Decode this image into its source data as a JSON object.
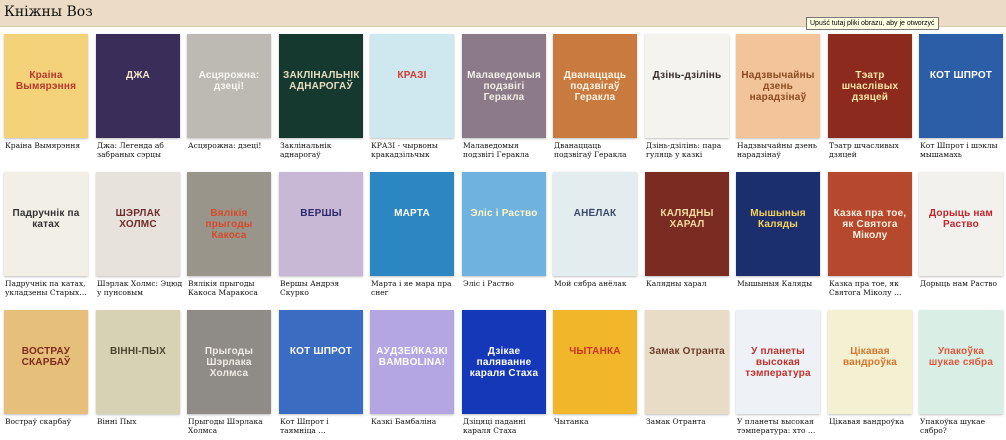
{
  "app": {
    "title": "Кніжны Воз",
    "tooltip": "Upuść tutaj pliki obrazu, aby je otworzyć"
  },
  "rows": [
    [
      {
        "title": "Краіна Вымярэння",
        "cover_text": "Краіна Вымярэння",
        "bg": "#f3d27a",
        "fg": "#b6382c"
      },
      {
        "title": "Джа: Легенда аб забраных сэрцы",
        "cover_text": "ДЖА",
        "bg": "#3a2d5a",
        "fg": "#f1e7c6"
      },
      {
        "title": "Асцярожна: дзеці!",
        "cover_text": "Асцярожна: дзеці!",
        "bg": "#bdbab3",
        "fg": "#f7f7f2"
      },
      {
        "title": "Заклінальнік аднарогаў",
        "cover_text": "ЗАКЛІНАЛЬНІК АДНАРОГАЎ",
        "bg": "#15382f",
        "fg": "#e6dcc0"
      },
      {
        "title": "КРАЗІ - чырвоны кракадзільчык",
        "cover_text": "КРАЗІ",
        "bg": "#cfe7ef",
        "fg": "#d23b2f"
      },
      {
        "title": "Малаведомыя подзвігі Геракла",
        "cover_text": "Малаведомыя подзвігі Геракла",
        "bg": "#8c7a88",
        "fg": "#f4efe8"
      },
      {
        "title": "Дванаццаць подзвігаў Геракла",
        "cover_text": "Дванаццаць подзвігаў Геракла",
        "bg": "#c97a3f",
        "fg": "#fff4e4"
      },
      {
        "title": "Дзінь-дзілінь: пара гуляць у казкі",
        "cover_text": "Дзінь-дзілінь",
        "bg": "#f4f3ef",
        "fg": "#3a2d2a"
      },
      {
        "title": "Надзвычайны дзень нарадзінаў",
        "cover_text": "Надзвычайны дзень нарадзінаў",
        "bg": "#f3c39a",
        "fg": "#8a4b1f"
      },
      {
        "title": "Тэатр шчасливых дзяцей",
        "cover_text": "Тэатр шчаслівых дзяцей",
        "bg": "#8c2a1d",
        "fg": "#f8e7a8"
      },
      {
        "title": "Кот Шпрот і шэклы мышамахь",
        "cover_text": "КОТ ШПРОТ",
        "bg": "#2c5ea8",
        "fg": "#ffffff"
      }
    ],
    [
      {
        "title": "Падручнік па катах, укладзены Старых…",
        "cover_text": "Падручнік па катах",
        "bg": "#f2efe6",
        "fg": "#333333"
      },
      {
        "title": "Шэрлак Холмс: Эцюд у пунсовым",
        "cover_text": "ШЭРЛАК ХОЛМС",
        "bg": "#e7e3dc",
        "fg": "#6f2a2a"
      },
      {
        "title": "Вялікія прыгоды Какоса Маракоса",
        "cover_text": "Вялікія прыгоды Какоса Маракоса",
        "bg": "#9a958a",
        "fg": "#d44a2a"
      },
      {
        "title": "Вершы Андрэя Скурко",
        "cover_text": "ВЕРШЫ",
        "bg": "#c9b7d6",
        "fg": "#2b2b6a"
      },
      {
        "title": "Марта і яе мара пра снег",
        "cover_text": "МАРТА",
        "bg": "#2b86c2",
        "fg": "#ffffff"
      },
      {
        "title": "Эліс і Раство",
        "cover_text": "Эліс і Раство",
        "bg": "#6fb2e0",
        "fg": "#fff6c4"
      },
      {
        "title": "Мой сябра анёлак",
        "cover_text": "АНЁЛАК",
        "bg": "#e3ecef",
        "fg": "#3a4a6a"
      },
      {
        "title": "Калядны харал",
        "cover_text": "КАЛЯДНЫ ХАРАЛ",
        "bg": "#7a2b22",
        "fg": "#f3d9a0"
      },
      {
        "title": "Мышыныя Каляды",
        "cover_text": "Мышыныя Каляды",
        "bg": "#1b2f6e",
        "fg": "#f7d25a"
      },
      {
        "title": "Казка пра тое, як Святога Міколу …",
        "cover_text": "Казка пра тое, як Святога Міколу",
        "bg": "#b5482d",
        "fg": "#fff1e0"
      },
      {
        "title": "Дорыць нам Раство",
        "cover_text": "Дорыць нам Раство",
        "bg": "#f2f1ee",
        "fg": "#c0272d"
      }
    ],
    [
      {
        "title": "Востраў скарбаў",
        "cover_text": "ВОСТРАЎ СКАРБАЎ",
        "bg": "#e6c07a",
        "fg": "#7a2b1c"
      },
      {
        "title": "Вінні Пых",
        "cover_text": "ВІННІ-ПЫХ",
        "bg": "#d8d2b4",
        "fg": "#4a4630"
      },
      {
        "title": "Прыгоды Шэрлака Холмса",
        "cover_text": "Прыгоды Шэрлака Холмса",
        "bg": "#8f8b86",
        "fg": "#f0ece4"
      },
      {
        "title": "Кот Шпрот і таямніца …",
        "cover_text": "КОТ ШПРОТ",
        "bg": "#3a6cc2",
        "fg": "#ffffff"
      },
      {
        "title": "Казкі Бамбаліна",
        "cover_text": "АЎДЗЕЙКАЗКІ BAMBOLINA!",
        "bg": "#b3a6e2",
        "fg": "#ffffff"
      },
      {
        "title": "Дзіцяці паданні караля Стаха",
        "cover_text": "Дзікае паляванне караля Стаха",
        "bg": "#1538b8",
        "fg": "#ffffff"
      },
      {
        "title": "Чытанка",
        "cover_text": "ЧЫТАНКА",
        "bg": "#f2b62a",
        "fg": "#c8321f"
      },
      {
        "title": "Замак Отранта",
        "cover_text": "Замак Отранта",
        "bg": "#e8dcc6",
        "fg": "#6a3d2a"
      },
      {
        "title": "У планеты высокая тэмпература: хто …",
        "cover_text": "У планеты высокая тэмпература",
        "bg": "#eef2f6",
        "fg": "#c0302a"
      },
      {
        "title": "Цікавая вандроўка",
        "cover_text": "Цікавая вандроўка",
        "bg": "#f4f0d2",
        "fg": "#d8752a"
      },
      {
        "title": "Упакоўка шукае сябро?",
        "cover_text": "Упакоўка шукае сябра",
        "bg": "#d9efe6",
        "fg": "#e0573a"
      }
    ]
  ]
}
